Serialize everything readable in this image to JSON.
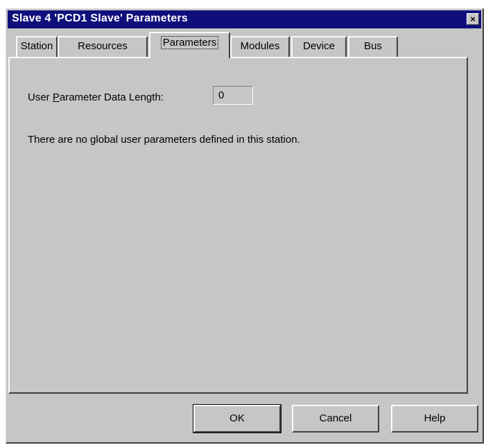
{
  "window": {
    "title": "Slave 4 'PCD1 Slave' Parameters",
    "close_glyph": "×"
  },
  "tabs": [
    {
      "label": "Station",
      "active": false
    },
    {
      "label": "Resources",
      "active": false
    },
    {
      "label": "Parameters",
      "active": true
    },
    {
      "label": "Modules",
      "active": false
    },
    {
      "label": "Device",
      "active": false
    },
    {
      "label": "Bus",
      "active": false
    }
  ],
  "parameters_page": {
    "data_length_label_prefix": "User ",
    "data_length_label_mnemonic": "P",
    "data_length_label_suffix": "arameter Data Length:",
    "data_length_value": "0",
    "info_message": "There are no global user parameters defined in this station."
  },
  "buttons": {
    "ok": "OK",
    "cancel": "Cancel",
    "help": "Help"
  },
  "icons": {
    "close": "close-icon"
  }
}
